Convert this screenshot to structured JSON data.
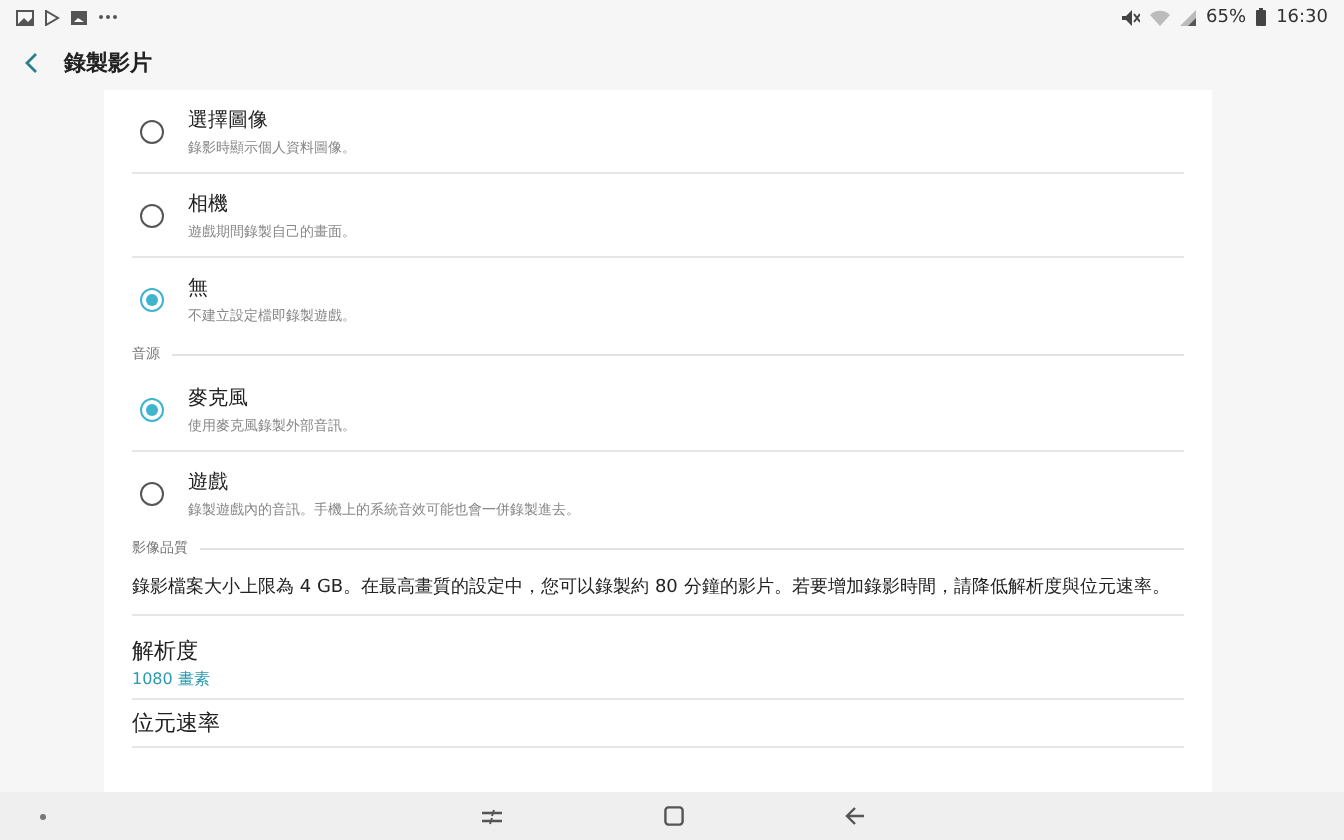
{
  "status_bar": {
    "battery": "65%",
    "time": "16:30"
  },
  "header": {
    "title": "錄製影片"
  },
  "sections": [
    {
      "kind": "radios",
      "items": [
        {
          "title": "選擇圖像",
          "subtitle": "錄影時顯示個人資料圖像。",
          "selected": false
        },
        {
          "title": "相機",
          "subtitle": "遊戲期間錄製自己的畫面。",
          "selected": false
        },
        {
          "title": "無",
          "subtitle": "不建立設定檔即錄製遊戲。",
          "selected": true
        }
      ]
    },
    {
      "kind": "radios",
      "heading": "音源",
      "items": [
        {
          "title": "麥克風",
          "subtitle": "使用麥克風錄製外部音訊。",
          "selected": true
        },
        {
          "title": "遊戲",
          "subtitle": "錄製遊戲內的音訊。手機上的系統音效可能也會一併錄製進去。",
          "selected": false
        }
      ]
    },
    {
      "kind": "settings",
      "heading": "影像品質",
      "note": "錄影檔案大小上限為 4 GB。在最高畫質的設定中，您可以錄製約 80 分鐘的影片。若要增加錄影時間，請降低解析度與位元速率。",
      "items": [
        {
          "title": "解析度",
          "value": "1080 畫素"
        },
        {
          "title": "位元速率"
        }
      ]
    }
  ]
}
